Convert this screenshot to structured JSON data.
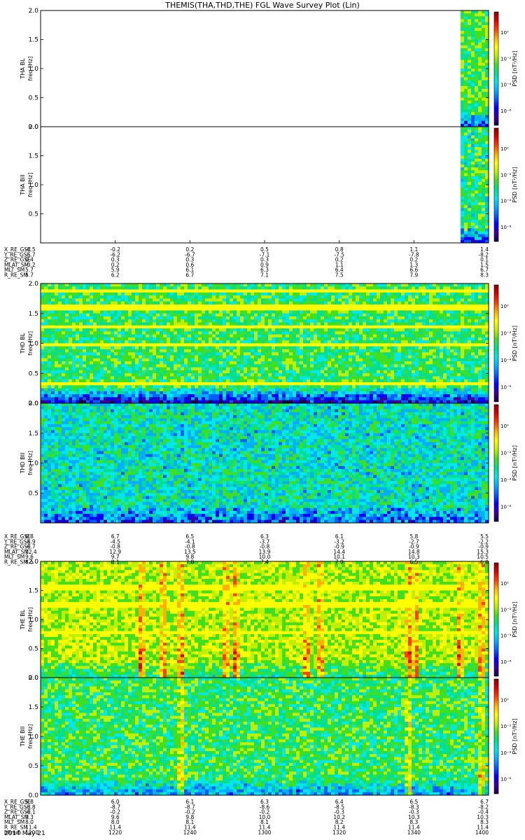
{
  "title": "THEMIS(THA,THD,THE) FGL Wave Survey Plot (Lin)",
  "date_label": "2014 May 21",
  "colors": {
    "colormap": [
      "#1a0040",
      "#3c00a0",
      "#0000ff",
      "#0060ff",
      "#00b0ff",
      "#00e8e8",
      "#00e090",
      "#40e020",
      "#c0f000",
      "#ffff00",
      "#ffb000",
      "#ff4000",
      "#e00000",
      "#8a0000"
    ]
  },
  "chart_data": [
    {
      "type": "heatmap",
      "probe": "THA",
      "component": "B_L",
      "ylabel_top": "THA BL",
      "ylabel": "freq [Hz]",
      "yticks": [
        "0.0",
        "0.5",
        "1.0",
        "1.5",
        "2.0"
      ],
      "ylim": [
        0,
        2.0
      ],
      "colorbar_label": "PSD [nT²/Hz]",
      "colorbar_ticks": [
        "10⁰",
        "10⁻²",
        "10⁻⁴",
        "10⁻⁶"
      ],
      "xlim": [
        0,
        1
      ],
      "data_start": 0.944,
      "data_note": "data only in last interval",
      "mean_level": 0.52,
      "noise": 0.12,
      "low_band_drop": 0.25,
      "lines": []
    },
    {
      "type": "heatmap",
      "probe": "THA",
      "component": "B_II",
      "ylabel_top": "THA BII",
      "ylabel": "freq [Hz]",
      "yticks": [
        "0.5",
        "1.0",
        "1.5",
        "2.0"
      ],
      "ylim": [
        0,
        2.0
      ],
      "colorbar_label": "PSD [nT²/Hz]",
      "colorbar_ticks": [
        "10⁰",
        "10⁻²",
        "10⁻⁴",
        "10⁻⁶"
      ],
      "xlim": [
        0,
        1
      ],
      "data_start": 0.944,
      "mean_level": 0.48,
      "noise": 0.14,
      "low_band_drop": 0.2,
      "lines": []
    },
    {
      "type": "heatmap",
      "probe": "THD",
      "component": "B_L",
      "ylabel_top": "THD BL",
      "ylabel": "freq [Hz]",
      "yticks": [
        "0.0",
        "0.5",
        "1.0",
        "1.5",
        "2.0"
      ],
      "ylim": [
        0,
        2.0
      ],
      "colorbar_label": "PSD [nT²/Hz]",
      "colorbar_ticks": [
        "10⁰",
        "10⁻²",
        "10⁻⁴",
        "10⁻⁶"
      ],
      "xlim": [
        0,
        1
      ],
      "data_start": 0.0,
      "mean_level": 0.5,
      "noise": 0.12,
      "low_band_drop": 0.35,
      "lines": [
        0.97,
        0.31,
        1.6,
        1.28,
        1.86
      ]
    },
    {
      "type": "heatmap",
      "probe": "THD",
      "component": "B_II",
      "ylabel_top": "THD BII",
      "ylabel": "freq [Hz]",
      "yticks": [
        "0.5",
        "1.0",
        "1.5",
        "2.0"
      ],
      "ylim": [
        0,
        2.0
      ],
      "colorbar_label": "PSD [nT²/Hz]",
      "colorbar_ticks": [
        "10⁰",
        "10⁻²",
        "10⁻⁴",
        "10⁻⁶"
      ],
      "xlim": [
        0,
        1
      ],
      "data_start": 0.0,
      "mean_level": 0.42,
      "noise": 0.14,
      "low_band_drop": 0.15,
      "lines": []
    },
    {
      "type": "heatmap",
      "probe": "THE",
      "component": "B_L",
      "ylabel_top": "THE BL",
      "ylabel": "freq [Hz]",
      "yticks": [
        "0.0",
        "0.5",
        "1.0",
        "1.5",
        "2.0"
      ],
      "ylim": [
        0,
        2.0
      ],
      "colorbar_label": "PSD [nT²/Hz]",
      "colorbar_ticks": [
        "10⁰",
        "10⁻²",
        "10⁻⁴",
        "10⁻⁶"
      ],
      "xlim": [
        0,
        1
      ],
      "data_start": 0.0,
      "mean_level": 0.6,
      "noise": 0.1,
      "low_band_drop": 0.1,
      "lines": [
        0.77,
        1.25,
        1.55
      ],
      "bursts": [
        0.22,
        0.27,
        0.31,
        0.41,
        0.43,
        0.59,
        0.62,
        0.82,
        0.835,
        0.93,
        0.98
      ]
    },
    {
      "type": "heatmap",
      "probe": "THE",
      "component": "B_II",
      "ylabel_top": "THE BII",
      "ylabel": "freq [Hz]",
      "yticks": [
        "0.0",
        "0.5",
        "1.0",
        "1.5",
        "2.0"
      ],
      "ylim": [
        0,
        2.0
      ],
      "colorbar_label": "PSD [nT²/Hz]",
      "colorbar_ticks": [
        "10⁰",
        "10⁻²",
        "10⁻⁴",
        "10⁻⁶"
      ],
      "xlim": [
        0,
        1
      ],
      "data_start": 0.0,
      "mean_level": 0.5,
      "noise": 0.12,
      "low_band_drop": 0.15,
      "lines": [],
      "bursts": [
        0.31,
        0.82,
        0.98
      ]
    }
  ],
  "ephemeris": [
    {
      "probe": "THA",
      "rows": [
        {
          "label": "X_RE_GSE",
          "values": [
            "-0.5",
            "-0.2",
            "0.2",
            "0.5",
            "0.8",
            "1.1",
            "1.4"
          ]
        },
        {
          "label": "Y_RE_GSE",
          "values": [
            "-5.7",
            "-6.2",
            "-6.7",
            "-7.1",
            "-7.5",
            "-7.8",
            "-8.2"
          ]
        },
        {
          "label": "Z_RE_GSE",
          "values": [
            "0.4",
            "0.3",
            "0.3",
            "0.3",
            "0.2",
            "0.2",
            "0.1"
          ]
        },
        {
          "label": "MLAT_SM",
          "values": [
            "-0.2",
            "0.2",
            "0.6",
            "0.9",
            "1.1",
            "1.3",
            "1.5"
          ]
        },
        {
          "label": "MLT_SM",
          "values": [
            "5.7",
            "5.9",
            "6.1",
            "6.3",
            "6.4",
            "6.6",
            "6.7"
          ]
        },
        {
          "label": "R_RE_SM",
          "values": [
            "5.7",
            "6.2",
            "6.7",
            "7.1",
            "7.5",
            "7.9",
            "8.3"
          ]
        }
      ]
    },
    {
      "probe": "THD",
      "rows": [
        {
          "label": "X_RE_GSE",
          "values": [
            "6.8",
            "6.7",
            "6.5",
            "6.3",
            "6.1",
            "5.8",
            "5.5"
          ]
        },
        {
          "label": "Y_RE_GSE",
          "values": [
            "-4.9",
            "-4.5",
            "-4.1",
            "-3.7",
            "-3.2",
            "-2.7",
            "-2.2"
          ]
        },
        {
          "label": "Z_RE_GSE",
          "values": [
            "-0.7",
            "-0.8",
            "-0.8",
            "-0.8",
            "-0.9",
            "-0.9",
            "-0.9"
          ]
        },
        {
          "label": "MLAT_SM",
          "values": [
            "12.4",
            "12.9",
            "13.5",
            "13.9",
            "14.4",
            "14.8",
            "15.3"
          ]
        },
        {
          "label": "MLT_SM",
          "values": [
            "9.6",
            "9.7",
            "9.8",
            "10.0",
            "10.1",
            "10.3",
            "10.5"
          ]
        },
        {
          "label": "R_RE_SM",
          "values": [
            "8.5",
            "8.1",
            "7.8",
            "7.4",
            "7.0",
            "6.5",
            "6.0"
          ]
        }
      ]
    },
    {
      "probe": "THE",
      "rows": [
        {
          "label": "X_RE_GSE",
          "values": [
            "5.8",
            "6.0",
            "6.1",
            "6.3",
            "6.4",
            "6.5",
            "6.7"
          ]
        },
        {
          "label": "Y_RE_GSE",
          "values": [
            "-8.8",
            "-8.7",
            "-8.7",
            "-8.6",
            "-8.5",
            "-8.3",
            "-8.2"
          ]
        },
        {
          "label": "Z_RE_GSE",
          "values": [
            "-0.1",
            "-0.2",
            "-0.2",
            "-0.2",
            "-0.3",
            "-0.3",
            "-0.4"
          ]
        },
        {
          "label": "MLAT_SM",
          "values": [
            "9.3",
            "9.6",
            "9.8",
            "10.0",
            "10.2",
            "10.3",
            "10.3"
          ]
        },
        {
          "label": "MLT_SM",
          "values": [
            "8.0",
            "8.0",
            "8.1",
            "8.1",
            "8.2",
            "8.3",
            "8.3"
          ]
        },
        {
          "label": "R_RE_SM",
          "values": [
            "11.4",
            "11.4",
            "11.4",
            "11.4",
            "11.4",
            "11.4",
            "11.4"
          ]
        },
        {
          "label": "hhmm",
          "values": [
            "1200",
            "1220",
            "1240",
            "1300",
            "1320",
            "1340",
            "1400"
          ]
        }
      ]
    }
  ]
}
